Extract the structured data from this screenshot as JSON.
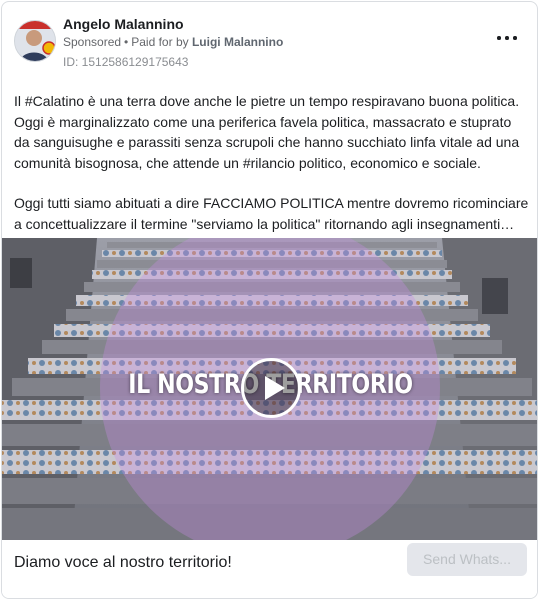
{
  "post": {
    "author_name": "Angelo Malannino",
    "sponsored_label": "Sponsored",
    "separator": "•",
    "paid_for_prefix": "Paid for by",
    "paid_for_name": "Luigi Malannino",
    "ad_id": "ID: 1512586129175643",
    "more_icon": "more-horizontal-icon",
    "paragraphs": [
      "Il #Calatino è una terra dove anche le pietre un tempo respiravano buona politica. Oggi è marginalizzato come una periferica favela politica, massacrato e stuprato da sanguisughe e parassiti senza scrupoli che hanno succhiato linfa vitale ad una comunità bisognosa, che attende un #rilancio politico, economico e sociale.",
      "Oggi tutti siamo abituati a dire FACCIAMO POLITICA mentre dovremo ricominciare a concettualizzare il termine \"serviamo la politica\" ritornando agli insegnamenti…"
    ]
  },
  "media": {
    "overlay_text": "IL NOSTRO TERRITORIO",
    "play_icon": "play-icon"
  },
  "footer": {
    "headline": "Diamo voce al nostro territorio!",
    "cta_label": "Send Whats..."
  },
  "colors": {
    "overlay_circle": "#c78be3",
    "cta_background": "#e4e6eb",
    "cta_text": "#bcc0c4"
  }
}
